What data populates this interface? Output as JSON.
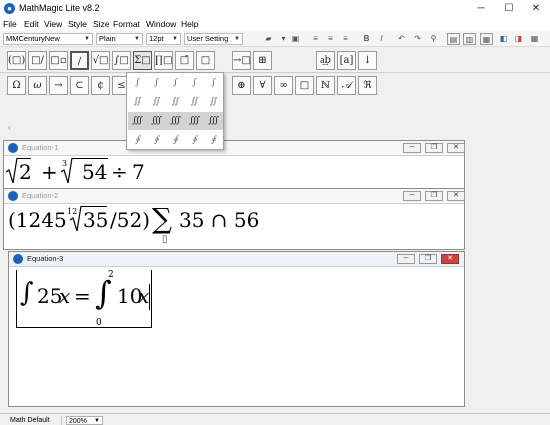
{
  "app": {
    "title": "MathMagic Lite v8.2"
  },
  "window_controls": {
    "minimize": "─",
    "maximize": "☐",
    "close": "✕"
  },
  "menu": [
    "File",
    "Edit",
    "View",
    "Style",
    "Size",
    "Format",
    "Window",
    "Help"
  ],
  "format_bar": {
    "font": "MMCenturyNew",
    "style": "Plain",
    "size": "12pt",
    "setting": "User Setting",
    "bold": "B",
    "italic": "I"
  },
  "palette_row1": [
    "(□)",
    "□/□",
    "□▫",
    "∕",
    "√□",
    "∫□",
    "Σ□",
    "∏□",
    "□̄",
    "□",
    "→□",
    "⊞",
    "a͢b",
    "[a]",
    "↓"
  ],
  "palette_row2": [
    "Ω",
    "ω",
    "→",
    "⊂",
    "¢",
    "≤",
    "⊕",
    "∀",
    "∞",
    "□",
    "ℕ",
    "𝒜",
    "ℜ"
  ],
  "integral_dropdown": [
    [
      "∫",
      "∫",
      "∫",
      "∫",
      "∫"
    ],
    [
      "∬",
      "∬",
      "∬",
      "∬",
      "∬"
    ],
    [
      "∭",
      "∭",
      "∭",
      "∭",
      "∭"
    ],
    [
      "∮",
      "∮",
      "∮",
      "∮",
      "∮"
    ]
  ],
  "equations": [
    {
      "title": "Equation-1",
      "expr": {
        "radicand1": "2",
        "plus": "+",
        "index": "3",
        "radicand2": "54",
        "div": "÷",
        "num": "7"
      }
    },
    {
      "title": "Equation-2",
      "expr": {
        "open": "(1245",
        "index": "12",
        "radicand": "35",
        "rest": "/52)",
        "sum": "∑",
        "body": "35 ∩ 56",
        "placeholder": "▯"
      }
    },
    {
      "title": "Equation-3",
      "expr": {
        "int1": "∫",
        "lhs": "25",
        "var1": "x",
        "eq": "=",
        "int2": "∫",
        "upper": "2",
        "lower": "0",
        "coef": "10",
        "var2": "x"
      }
    }
  ],
  "status": {
    "mode": "Math Default",
    "zoom": "200%"
  },
  "colors": {
    "accent": "#1e63b8",
    "close": "#c94343"
  }
}
